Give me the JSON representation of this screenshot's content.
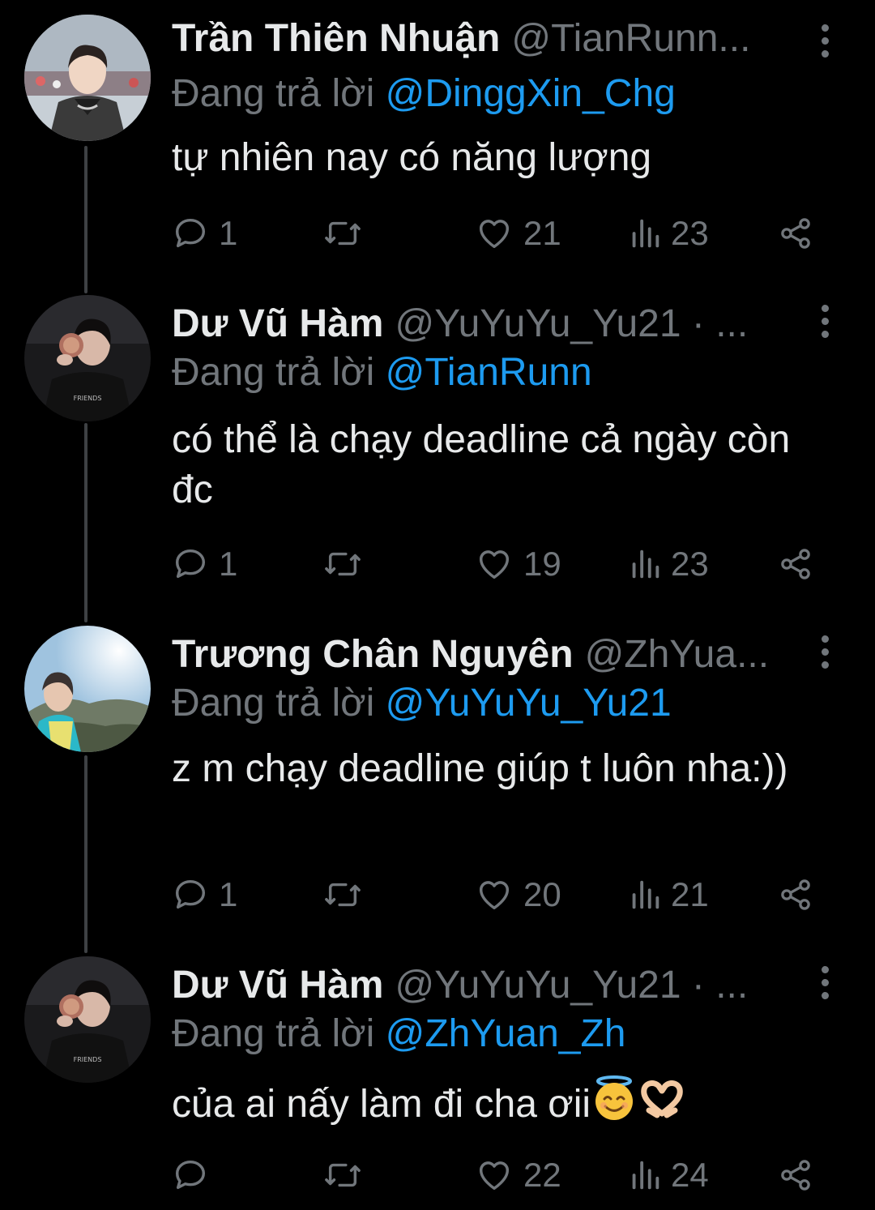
{
  "colors": {
    "background": "#000000",
    "text": "#e7e9ea",
    "muted": "#71767b",
    "mention": "#1d9bf0",
    "thread_line": "#3e4144"
  },
  "reply_prefix": "Đang trả lời",
  "tweets": [
    {
      "name": "Trần Thiên Nhuận",
      "handle": "@TianRunn...",
      "reply_to": "@DinggXin_Chg",
      "text": "tự nhiên nay có năng lượng",
      "emojis": [],
      "replies": "1",
      "retweets": "",
      "likes": "21",
      "views": "23"
    },
    {
      "name": "Dư Vũ Hàm",
      "handle": "@YuYuYu_Yu21 · ...",
      "reply_to": "@TianRunn",
      "text": "có thể là chạy deadline cả ngày còn đc",
      "emojis": [],
      "replies": "1",
      "retweets": "",
      "likes": "19",
      "views": "23"
    },
    {
      "name": "Trương Chân Nguyên",
      "handle": "@ZhYua...",
      "reply_to": "@YuYuYu_Yu21",
      "text": "z m chạy deadline giúp t luôn nha:))",
      "emojis": [],
      "replies": "1",
      "retweets": "",
      "likes": "20",
      "views": "21"
    },
    {
      "name": "Dư Vũ Hàm",
      "handle": "@YuYuYu_Yu21 · ...",
      "reply_to": "@ZhYuan_Zh",
      "text": "của ai nấy làm đi cha ơii",
      "emojis": [
        "smiling-face-with-halo",
        "heart-hands"
      ],
      "replies": "",
      "retweets": "",
      "likes": "22",
      "views": "24"
    }
  ],
  "icons": {
    "reply": "reply-bubble-icon",
    "retweet": "retweet-icon",
    "like": "heart-icon",
    "views": "views-chart-icon",
    "share": "share-icon",
    "more": "more-vertical-icon"
  }
}
